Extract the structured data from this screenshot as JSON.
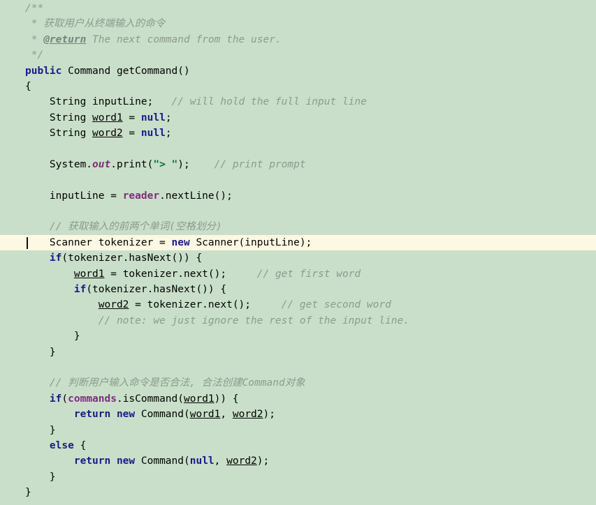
{
  "editor": {
    "background_color": "#c9dfc9",
    "highlight_color": "#fdf8e3",
    "keyword_color": "#1a1a8c",
    "field_color": "#7d2d7d",
    "string_color": "#0a6b3d",
    "comment_color": "#8e9a8e",
    "text_color": "#000000",
    "caret_line_index": 14,
    "language": "Java"
  },
  "code": {
    "lines": [
      {
        "indent": 1,
        "tokens": [
          {
            "t": "/**",
            "c": "jdoc"
          }
        ]
      },
      {
        "indent": 1,
        "tokens": [
          {
            "t": " * 获取用户从终端输入的命令",
            "c": "jdoc"
          }
        ]
      },
      {
        "indent": 1,
        "tokens": [
          {
            "t": " * ",
            "c": "jdoc"
          },
          {
            "t": "@return",
            "c": "jtag"
          },
          {
            "t": " The next command from the user.",
            "c": "jdoc"
          }
        ]
      },
      {
        "indent": 1,
        "tokens": [
          {
            "t": " */",
            "c": "jdoc"
          }
        ]
      },
      {
        "indent": 0,
        "tokens": [
          {
            "t": "public",
            "c": "kw"
          },
          {
            "t": " Command getCommand()",
            "c": "plain"
          }
        ]
      },
      {
        "indent": 0,
        "tokens": [
          {
            "t": "{",
            "c": "plain"
          }
        ]
      },
      {
        "indent": 0,
        "tokens": [
          {
            "t": "    String inputLine;   ",
            "c": "plain"
          },
          {
            "t": "// will hold the full input line",
            "c": "cmt"
          }
        ]
      },
      {
        "indent": 0,
        "tokens": [
          {
            "t": "    String ",
            "c": "plain"
          },
          {
            "t": "word1",
            "c": "var"
          },
          {
            "t": " = ",
            "c": "plain"
          },
          {
            "t": "null",
            "c": "kw"
          },
          {
            "t": ";",
            "c": "plain"
          }
        ]
      },
      {
        "indent": 0,
        "tokens": [
          {
            "t": "    String ",
            "c": "plain"
          },
          {
            "t": "word2",
            "c": "var"
          },
          {
            "t": " = ",
            "c": "plain"
          },
          {
            "t": "null",
            "c": "kw"
          },
          {
            "t": ";",
            "c": "plain"
          }
        ]
      },
      {
        "indent": 0,
        "tokens": []
      },
      {
        "indent": 0,
        "tokens": [
          {
            "t": "    System.",
            "c": "plain"
          },
          {
            "t": "out",
            "c": "fldi"
          },
          {
            "t": ".print(",
            "c": "plain"
          },
          {
            "t": "\"> \"",
            "c": "str"
          },
          {
            "t": ");    ",
            "c": "plain"
          },
          {
            "t": "// print prompt",
            "c": "cmt"
          }
        ]
      },
      {
        "indent": 0,
        "tokens": []
      },
      {
        "indent": 0,
        "tokens": [
          {
            "t": "    inputLine = ",
            "c": "plain"
          },
          {
            "t": "reader",
            "c": "fld"
          },
          {
            "t": ".nextLine();",
            "c": "plain"
          }
        ]
      },
      {
        "indent": 0,
        "tokens": []
      },
      {
        "indent": 0,
        "tokens": [
          {
            "t": "    ",
            "c": "plain"
          },
          {
            "t": "// 获取输入的前两个单词(空格划分)",
            "c": "cmt"
          }
        ]
      },
      {
        "indent": 0,
        "highlight": true,
        "tokens": [
          {
            "t": "    Scanner tokenizer = ",
            "c": "plain"
          },
          {
            "t": "new",
            "c": "kw"
          },
          {
            "t": " Scanner(inputLine);",
            "c": "plain"
          }
        ]
      },
      {
        "indent": 0,
        "tokens": [
          {
            "t": "    ",
            "c": "plain"
          },
          {
            "t": "if",
            "c": "kw"
          },
          {
            "t": "(tokenizer.hasNext()) {",
            "c": "plain"
          }
        ]
      },
      {
        "indent": 0,
        "tokens": [
          {
            "t": "        ",
            "c": "plain"
          },
          {
            "t": "word1",
            "c": "var"
          },
          {
            "t": " = tokenizer.next();     ",
            "c": "plain"
          },
          {
            "t": "// get first word",
            "c": "cmt"
          }
        ]
      },
      {
        "indent": 0,
        "tokens": [
          {
            "t": "        ",
            "c": "plain"
          },
          {
            "t": "if",
            "c": "kw"
          },
          {
            "t": "(tokenizer.hasNext()) {",
            "c": "plain"
          }
        ]
      },
      {
        "indent": 0,
        "tokens": [
          {
            "t": "            ",
            "c": "plain"
          },
          {
            "t": "word2",
            "c": "var"
          },
          {
            "t": " = tokenizer.next();     ",
            "c": "plain"
          },
          {
            "t": "// get second word",
            "c": "cmt"
          }
        ]
      },
      {
        "indent": 0,
        "tokens": [
          {
            "t": "            ",
            "c": "plain"
          },
          {
            "t": "// note: we just ignore the rest of the input line.",
            "c": "cmt"
          }
        ]
      },
      {
        "indent": 0,
        "tokens": [
          {
            "t": "        }",
            "c": "plain"
          }
        ]
      },
      {
        "indent": 0,
        "tokens": [
          {
            "t": "    }",
            "c": "plain"
          }
        ]
      },
      {
        "indent": 0,
        "tokens": []
      },
      {
        "indent": 0,
        "tokens": [
          {
            "t": "    ",
            "c": "plain"
          },
          {
            "t": "// 判断用户输入命令是否合法, 合法创建Command对象",
            "c": "cmt"
          }
        ]
      },
      {
        "indent": 0,
        "tokens": [
          {
            "t": "    ",
            "c": "plain"
          },
          {
            "t": "if",
            "c": "kw"
          },
          {
            "t": "(",
            "c": "plain"
          },
          {
            "t": "commands",
            "c": "fld"
          },
          {
            "t": ".isCommand(",
            "c": "plain"
          },
          {
            "t": "word1",
            "c": "var"
          },
          {
            "t": ")) {",
            "c": "plain"
          }
        ]
      },
      {
        "indent": 0,
        "tokens": [
          {
            "t": "        ",
            "c": "plain"
          },
          {
            "t": "return new",
            "c": "kw"
          },
          {
            "t": " Command(",
            "c": "plain"
          },
          {
            "t": "word1",
            "c": "var"
          },
          {
            "t": ", ",
            "c": "plain"
          },
          {
            "t": "word2",
            "c": "var"
          },
          {
            "t": ");",
            "c": "plain"
          }
        ]
      },
      {
        "indent": 0,
        "tokens": [
          {
            "t": "    }",
            "c": "plain"
          }
        ]
      },
      {
        "indent": 0,
        "tokens": [
          {
            "t": "    ",
            "c": "plain"
          },
          {
            "t": "else",
            "c": "kw"
          },
          {
            "t": " {",
            "c": "plain"
          }
        ]
      },
      {
        "indent": 0,
        "tokens": [
          {
            "t": "        ",
            "c": "plain"
          },
          {
            "t": "return new",
            "c": "kw"
          },
          {
            "t": " Command(",
            "c": "plain"
          },
          {
            "t": "null",
            "c": "kw"
          },
          {
            "t": ", ",
            "c": "plain"
          },
          {
            "t": "word2",
            "c": "var"
          },
          {
            "t": ");",
            "c": "plain"
          }
        ]
      },
      {
        "indent": 0,
        "tokens": [
          {
            "t": "    }",
            "c": "plain"
          }
        ]
      },
      {
        "indent": 0,
        "tokens": [
          {
            "t": "}",
            "c": "plain"
          }
        ]
      }
    ]
  }
}
